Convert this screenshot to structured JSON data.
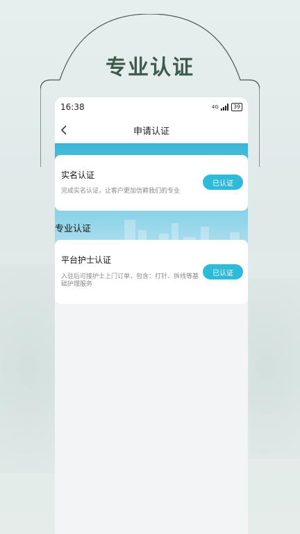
{
  "promo": {
    "title": "专业认证"
  },
  "status_bar": {
    "time": "16:38",
    "network": "4G",
    "battery": "39"
  },
  "nav": {
    "title": "申请认证",
    "back_icon": "chevron-left-icon"
  },
  "realname_card": {
    "title": "实名认证",
    "description": "完成实名认证，让客户更加信赖我们的专业",
    "button_label": "已认证"
  },
  "section": {
    "title": "专业认证"
  },
  "nurse_card": {
    "title": "平台护士认证",
    "description": "入驻后可接护士上门订单，包含：打针、拆线等基础护理服务",
    "button_label": "已认证"
  },
  "colors": {
    "accent": "#2dbbd9",
    "title_green": "#3f5a4c",
    "banner_top": "#39b5d8"
  }
}
